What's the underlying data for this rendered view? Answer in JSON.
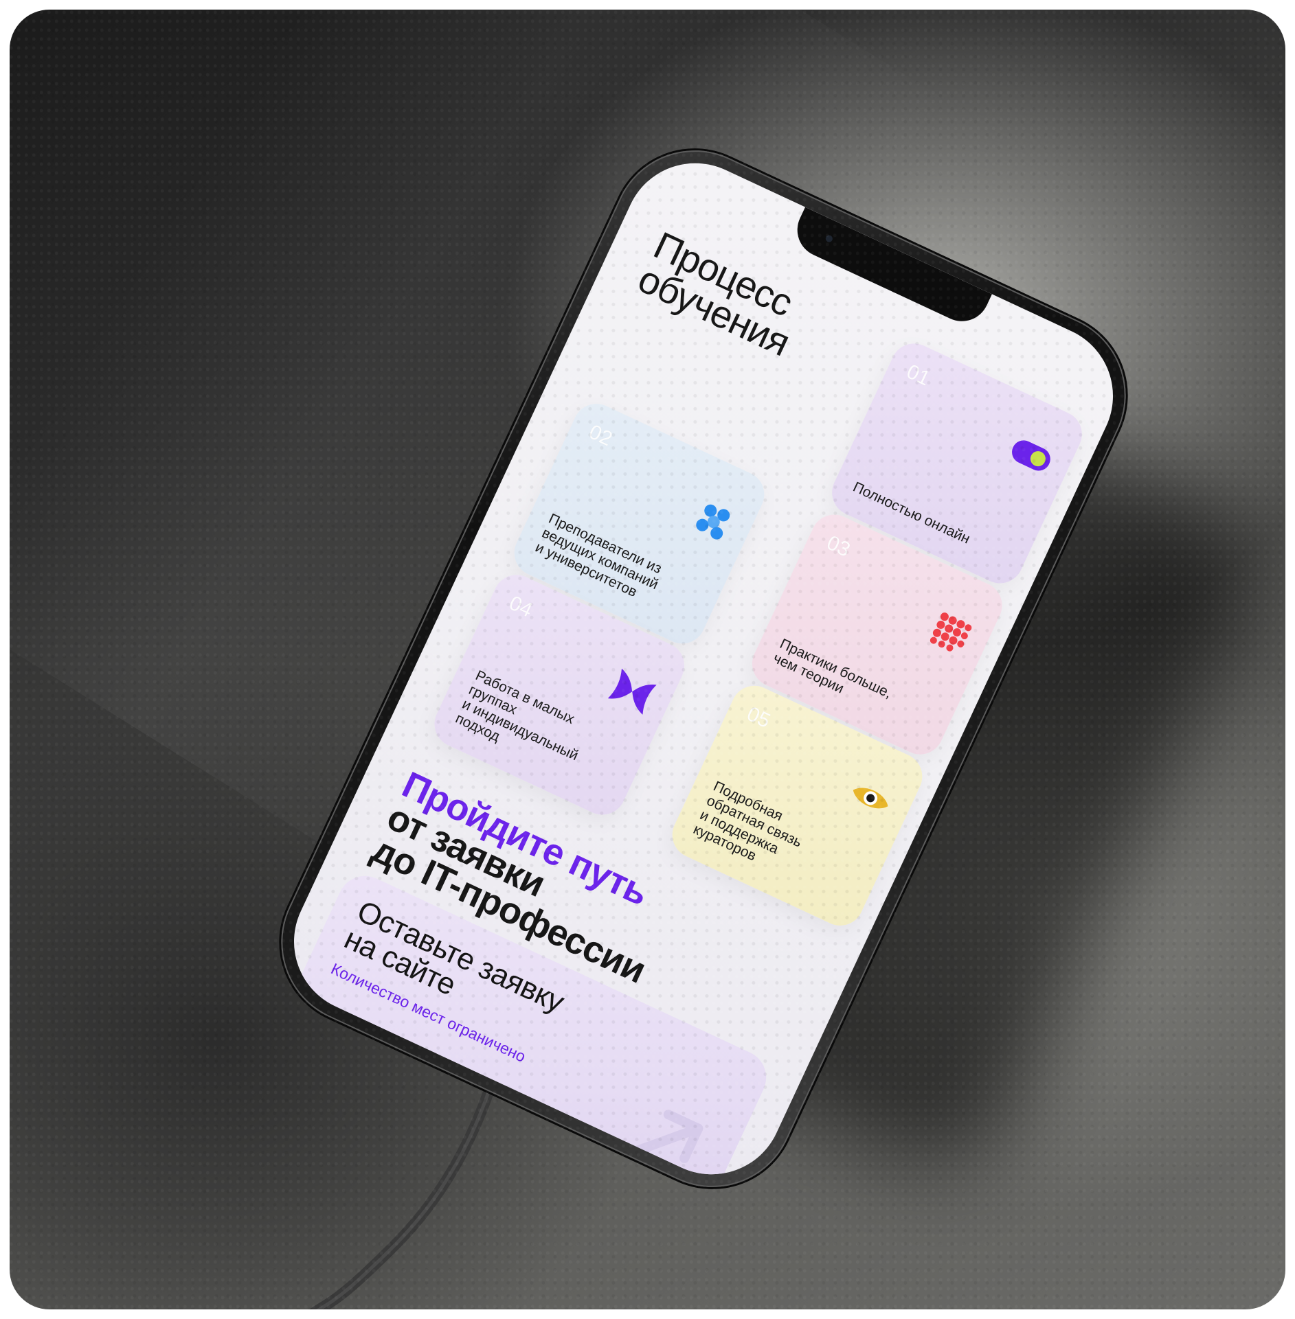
{
  "section": {
    "title_line1": "Процесс",
    "title_line2": "обучения"
  },
  "cards": [
    {
      "num": "01",
      "label": "Полностью онлайн",
      "icon": "toggle-switch-icon"
    },
    {
      "num": "02",
      "label": "Преподаватели из\nведущих компаний\nи университетов",
      "icon": "dots-cluster-icon"
    },
    {
      "num": "03",
      "label": "Практики больше,\nчем теории",
      "icon": "dot-grid-icon"
    },
    {
      "num": "04",
      "label": "Работа в малых\nгруппах\nи индивидуальный\nподход",
      "icon": "bowtie-icon"
    },
    {
      "num": "05",
      "label": "Подробная\nобратная связь\nи поддержка\nкураторов",
      "icon": "eye-icon"
    }
  ],
  "path": {
    "accent": "Пройдите путь",
    "line2": "от заявки",
    "line3": "до IT-профессии"
  },
  "cta": {
    "title": "Оставьте заявку\nна сайте",
    "subtitle": "Количество мест ограничено",
    "icon": "arrow-up-right-icon"
  },
  "colors": {
    "accent": "#6b23ea",
    "toggle_knob": "#c7e34a",
    "blue_dots": "#2a8ef0",
    "red_dots": "#ef4048",
    "eye": "#e8b62a"
  }
}
